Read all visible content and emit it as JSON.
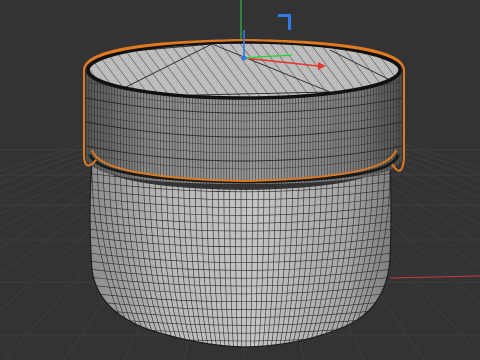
{
  "viewport": {
    "view": "perspective",
    "background_color": "#333335",
    "grid_color": "#3d3d40",
    "grid": true,
    "world_axes": {
      "x_axis_color": "#c83a32",
      "y_axis_color": "#2bbf3a",
      "z_axis_color": "#1b6fd8"
    }
  },
  "object": {
    "type": "cylindrical-jar",
    "display": "wireframe-over-shaded",
    "parts": [
      "lid",
      "body"
    ],
    "selection_outline_color": "#e07a1e",
    "surface_color": "#c9c9c9",
    "wire_color": "#2a2a2a"
  },
  "gizmo": {
    "mode": "move",
    "x_color": "#e23a2e",
    "y_color": "#35d04a",
    "z_color": "#2e7be8"
  }
}
